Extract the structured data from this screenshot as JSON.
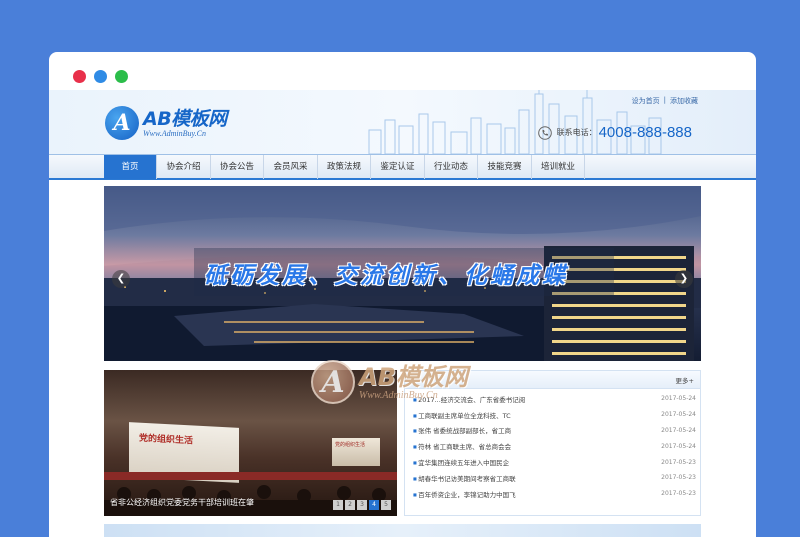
{
  "window": {
    "buttons": [
      "close",
      "minimize",
      "maximize"
    ],
    "colors": {
      "close": "#e8304a",
      "minimize": "#2f8be5",
      "maximize": "#2bbd4a"
    }
  },
  "header": {
    "logo_text": "AB模板网",
    "logo_mark": "A",
    "logo_url_text": "Www.AdminBuy.Cn",
    "links": [
      "设为首页",
      "|",
      "添加收藏"
    ],
    "phone_label": "联系电话：",
    "phone_number": "4008-888-888",
    "phone_icon": "phone-icon"
  },
  "nav": {
    "items": [
      "首页",
      "协会介绍",
      "协会公告",
      "会员风采",
      "政策法规",
      "鉴定认证",
      "行业动态",
      "技能竞赛",
      "培训就业"
    ],
    "active_index": 0,
    "accent": "#2673d0"
  },
  "banner": {
    "slogan": "砥砺发展、交流创新、化蛹成蝶",
    "prev_icon": "chevron-left-icon",
    "next_icon": "chevron-right-icon"
  },
  "photo": {
    "screen_title": "党的组织生活",
    "screen2_title": "党的组织生活",
    "caption": "省非公经济组织党委党务干部培训班在肇",
    "pages": [
      "1",
      "2",
      "3",
      "4",
      "5"
    ],
    "active_page": 3
  },
  "news": {
    "more": "更多+",
    "items": [
      {
        "title": "2017...经济交流会、广东省委书记阅",
        "date": "2017-05-24"
      },
      {
        "title": "工商联副主席单位全龙科技、TC",
        "date": "2017-05-24"
      },
      {
        "title": "张伟 省委统战部副部长，省工商",
        "date": "2017-05-24"
      },
      {
        "title": "符林 省工商联主席、省总商会会",
        "date": "2017-05-24"
      },
      {
        "title": "宜华集团连续五年进入中国民企",
        "date": "2017-05-23"
      },
      {
        "title": "胡春华书记访美期间考察省工商联",
        "date": "2017-05-23"
      },
      {
        "title": "百年侨资企业，李锦记助力中国飞",
        "date": "2017-05-23"
      }
    ]
  },
  "watermark": {
    "mark": "A",
    "title": "AB模板网",
    "sub": "Www.AdminBuy.Cn"
  }
}
